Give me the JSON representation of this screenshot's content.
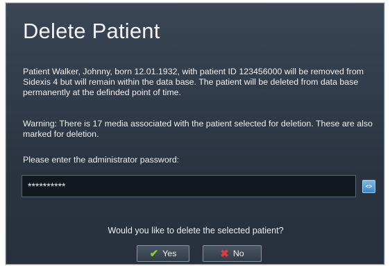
{
  "dialog": {
    "title": "Delete Patient",
    "message": "Patient Walker, Johnny, born 12.01.1932, with patient ID 123456000 will be removed from Sidexis 4 but will remain within the data base. The patient will be deleted from data base permanently at the definded point of time.",
    "warning": "Warning: There is 17 media associated with the patient selected for deletion. These are also marked for deletion.",
    "password_label": "Please enter the administrator password:",
    "password_value": "**********",
    "reveal_icon": "eye-icon",
    "question": "Would you like to delete the selected patient?",
    "yes_label": "Yes",
    "no_label": "No",
    "yes_icon": "checkmark-icon",
    "no_icon": "cross-icon"
  },
  "colors": {
    "dialog_bg": "#2b3542",
    "text": "#eef0f2",
    "accent": "#3e86c8",
    "yes_icon": "#7fd23a",
    "no_icon": "#e03a3a"
  }
}
